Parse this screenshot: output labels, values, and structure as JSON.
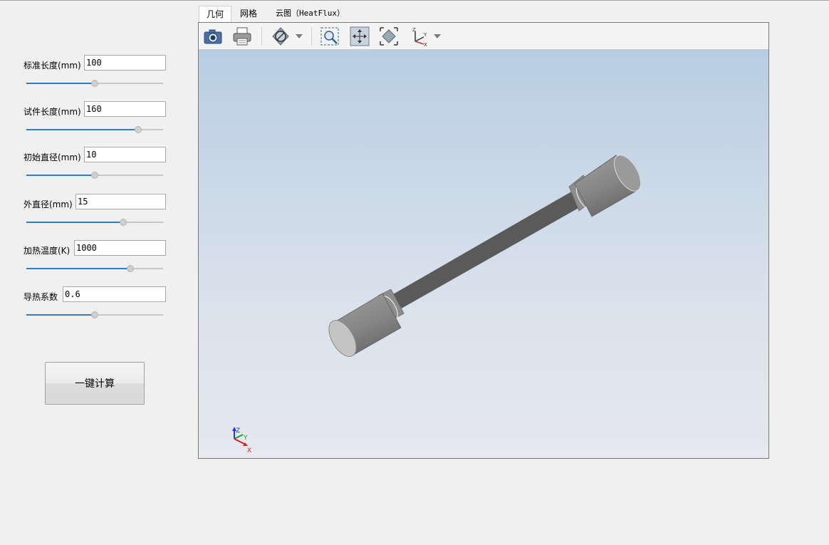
{
  "params": [
    {
      "label": "标准长度(mm)",
      "value": "100",
      "slider": 0.5
    },
    {
      "label": "试件长度(mm)",
      "value": "160",
      "slider": 0.82
    },
    {
      "label": "初始直径(mm)",
      "value": "10",
      "slider": 0.5
    },
    {
      "label": "外直径(mm)",
      "value": "15",
      "slider": 0.71
    },
    {
      "label": "加热温度(K)",
      "value": "1000",
      "slider": 0.76
    },
    {
      "label": "导热系数",
      "value": "0.6",
      "slider": 0.5
    }
  ],
  "calc_button_label": "一键计算",
  "tabs": [
    {
      "label": "几何",
      "active": true
    },
    {
      "label": "网格",
      "active": false
    },
    {
      "label": "云图（HeatFlux）",
      "active": false
    }
  ],
  "toolbar": {
    "icons": [
      "camera-icon",
      "print-icon",
      "display-mode-icon",
      "zoom-window-icon",
      "pan-icon",
      "fit-all-icon",
      "axis-view-icon"
    ]
  },
  "triad": {
    "x": "X",
    "y": "Y",
    "z": "Z"
  },
  "colors": {
    "accent": "#2f7dc9",
    "background_top": "#b8cde3",
    "background_bottom": "#e6e9ee",
    "model": "#8c8c8c"
  }
}
